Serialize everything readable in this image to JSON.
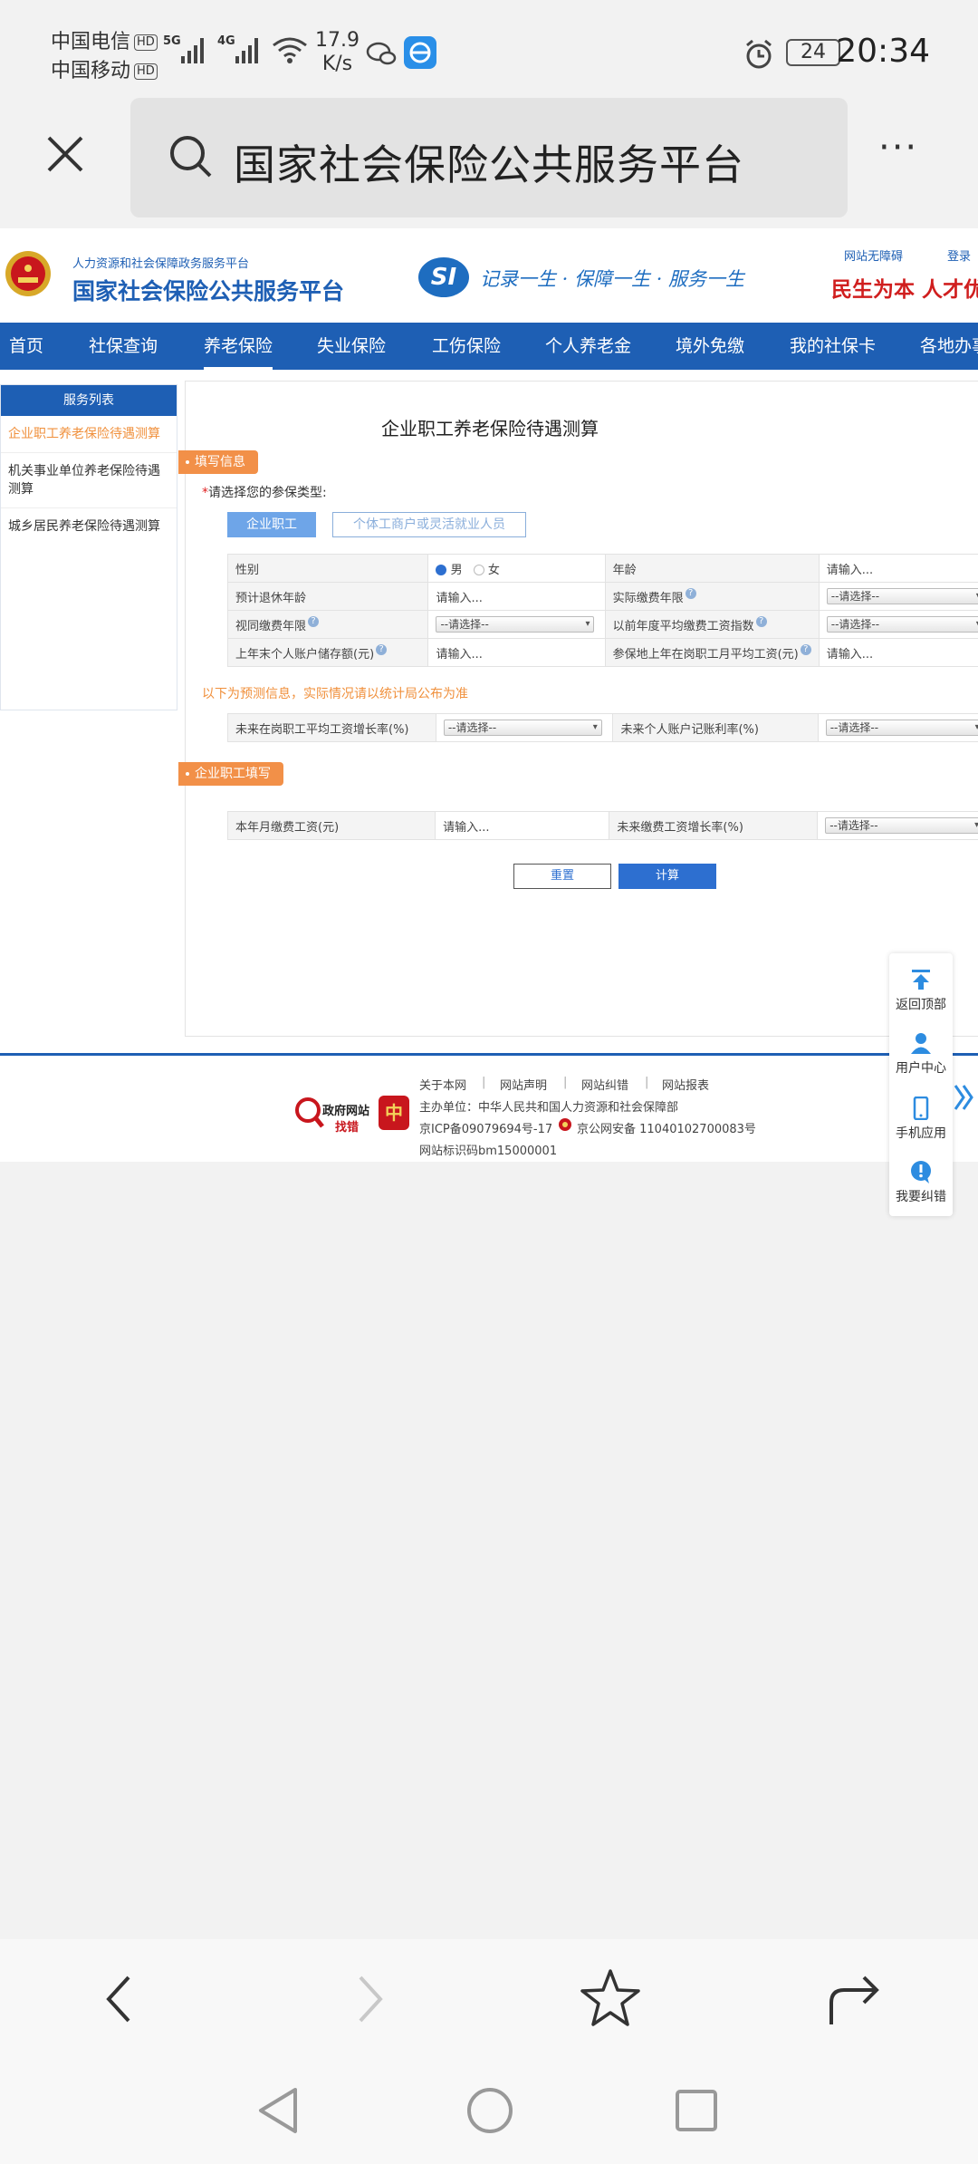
{
  "status_bar": {
    "carrier1": "中国电信",
    "carrier2": "中国移动",
    "hd": "HD",
    "signal1": "5G",
    "signal2": "4G",
    "speed_value": "17.9",
    "speed_unit": "K/s",
    "battery": "24",
    "time": "20:34"
  },
  "browser": {
    "title": "国家社会保险公共服务平台",
    "more": "···"
  },
  "site": {
    "header": {
      "dept": "人力资源和社会保障政务服务平台",
      "name": "国家社会保险公共服务平台",
      "si_logo": "SI",
      "slogan": "记录一生 · 保障一生 · 服务一生",
      "accessibility": "网站无障碍",
      "login": "登录",
      "motto": "民生为本 人才优"
    },
    "nav": [
      "首页",
      "社保查询",
      "养老保险",
      "失业保险",
      "工伤保险",
      "个人养老金",
      "境外免缴",
      "我的社保卡",
      "各地办事"
    ],
    "sidebar": {
      "title": "服务列表",
      "items": [
        "企业职工养老保险待遇测算",
        "机关事业单位养老保险待遇测算",
        "城乡居民养老保险待遇测算"
      ]
    },
    "calc": {
      "title": "企业职工养老保险待遇测算",
      "section1": "填写信息",
      "type_prompt_star": "*",
      "type_prompt": "请选择您的参保类型:",
      "type_enterprise": "企业职工",
      "type_individual": "个体工商户或灵活就业人员",
      "row1": {
        "k1": "性别",
        "male": "男",
        "female": "女",
        "k2": "年龄",
        "v2": "请输入..."
      },
      "row2": {
        "k1": "预计退休年龄",
        "v1": "请输入...",
        "k2": "实际缴费年限",
        "v2": "--请选择--"
      },
      "row3": {
        "k1": "视同缴费年限",
        "v1": "--请选择--",
        "k2": "以前年度平均缴费工资指数",
        "v2": "--请选择--"
      },
      "row4": {
        "k1": "上年末个人账户储存额(元)",
        "v1": "请输入...",
        "k2": "参保地上年在岗职工月平均工资(元)",
        "v2": "请输入..."
      },
      "forecast_note": "以下为预测信息，实际情况请以统计局公布为准",
      "row5": {
        "k1": "未来在岗职工平均工资增长率(%)",
        "v1": "--请选择--",
        "k2": "未来个人账户记账利率(%)",
        "v2": "--请选择--"
      },
      "section2": "企业职工填写",
      "row6": {
        "k1": "本年月缴费工资(元)",
        "v1": "请输入...",
        "k2": "未来缴费工资增长率(%)",
        "v2": "--请选择--"
      },
      "reset": "重置",
      "compute": "计算"
    },
    "float": {
      "top": "返回顶部",
      "user": "用户中心",
      "mobile": "手机应用",
      "report": "我要纠错"
    },
    "footer": {
      "links": [
        "关于本网",
        "网站声明",
        "网站纠错",
        "网站报表"
      ],
      "sponsor": "主办单位：中华人民共和国人力资源和社会保障部",
      "icp": "京ICP备09079694号-17",
      "police": "京公网安备 11040102700083号",
      "site_code": "网站标识码bm15000001",
      "gov_site": "政府网站",
      "find_error": "找错",
      "badge": "中"
    }
  }
}
